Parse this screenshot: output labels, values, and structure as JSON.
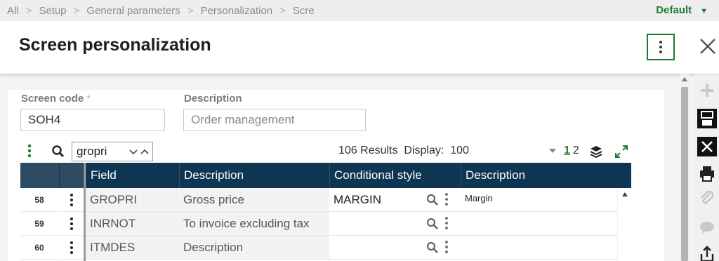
{
  "breadcrumb": [
    "All",
    "Setup",
    "General parameters",
    "Personalization",
    "Scre"
  ],
  "profile": {
    "label": "Default",
    "caret": "▼"
  },
  "header": {
    "title": "Screen personalization"
  },
  "form": {
    "screen_code": {
      "label": "Screen code",
      "required_mark": "*",
      "value": "SOH4"
    },
    "description": {
      "label": "Description",
      "placeholder": "Order management"
    }
  },
  "grid_toolbar": {
    "search_value": "gropri",
    "results_count": "106 Results",
    "display_label": "Display:",
    "display_value": "100",
    "pages": [
      "1",
      "2"
    ]
  },
  "grid": {
    "columns": [
      "Field",
      "Description",
      "Conditional style",
      "Description"
    ],
    "rows": [
      {
        "num": "58",
        "field": "GROPRI",
        "description": "Gross price",
        "style": "MARGIN",
        "style_desc": "Margin"
      },
      {
        "num": "59",
        "field": "INRNOT",
        "description": "To invoice excluding tax",
        "style": "",
        "style_desc": ""
      },
      {
        "num": "60",
        "field": "ITMDES",
        "description": "Description",
        "style": "",
        "style_desc": ""
      }
    ]
  },
  "colors": {
    "accent": "#1d7a35",
    "grid_header": "#0e3552"
  },
  "icons": {
    "toolbar": [
      "plus-icon",
      "save-icon",
      "cancel-icon",
      "print-icon",
      "attachment-icon",
      "comment-icon",
      "export-icon"
    ],
    "grid": [
      "grid-menu-icon",
      "search-icon",
      "layers-icon",
      "expand-icon"
    ]
  }
}
